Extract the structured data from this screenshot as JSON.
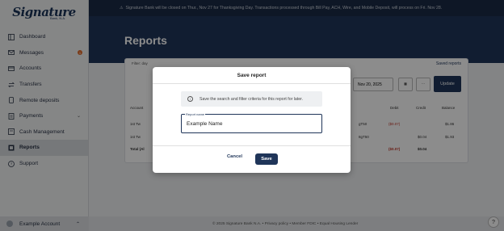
{
  "brand": {
    "name": "Signature",
    "sub": "Bank, N.A."
  },
  "banner": {
    "text": "Signature Bank will be closed on Thur., Nov 27 for Thanksgiving Day. Transactions processed through Bill Pay, ACH, Wire, and Mobile Deposit, will process on Fri. Nov 28."
  },
  "sidebar": {
    "items": [
      {
        "label": "Dashboard",
        "icon": "dashboard-icon"
      },
      {
        "label": "Messages",
        "icon": "mail-icon",
        "badge": "1"
      },
      {
        "label": "Accounts",
        "icon": "accounts-icon"
      },
      {
        "label": "Transfers",
        "icon": "transfer-icon"
      },
      {
        "label": "Remote deposits",
        "icon": "deposit-icon"
      },
      {
        "label": "Payments",
        "icon": "payment-icon"
      },
      {
        "label": "Cash Management",
        "icon": "cash-icon"
      },
      {
        "label": "Reports",
        "icon": "reports-icon"
      },
      {
        "label": "Support",
        "icon": "help-icon"
      }
    ],
    "account": "Example Account"
  },
  "page": {
    "title": "Reports"
  },
  "card": {
    "filter": "Filter: day",
    "saved_reports": "Saved reports",
    "date": "Nov 20, 2025",
    "update": "Update",
    "headers": {
      "account": "Account",
      "debit": "Debit",
      "credit": "Credit",
      "balance": "Balance"
    },
    "rows": [
      {
        "account": "1st Tw",
        "ref": "gT50",
        "debit": "($0.07)",
        "credit": "",
        "balance": "$1.86"
      },
      {
        "account": "1st Tw",
        "ref": "8gT50",
        "debit": "",
        "credit": "$0.04",
        "balance": "$1.93"
      },
      {
        "account": "Total (Al",
        "ref": "",
        "debit": "($0.07)",
        "credit": "$0.04",
        "balance": ""
      }
    ]
  },
  "footer": {
    "text": "© 2025 Signature Bank N.A. • Privacy policy • Member FDIC • Equal Housing Lender"
  },
  "modal": {
    "title": "Save report",
    "info": "Save the search and filter criteria for this report for later.",
    "field_label": "Report name",
    "field_value": "Example Name",
    "cancel": "Cancel",
    "save": "Save"
  }
}
